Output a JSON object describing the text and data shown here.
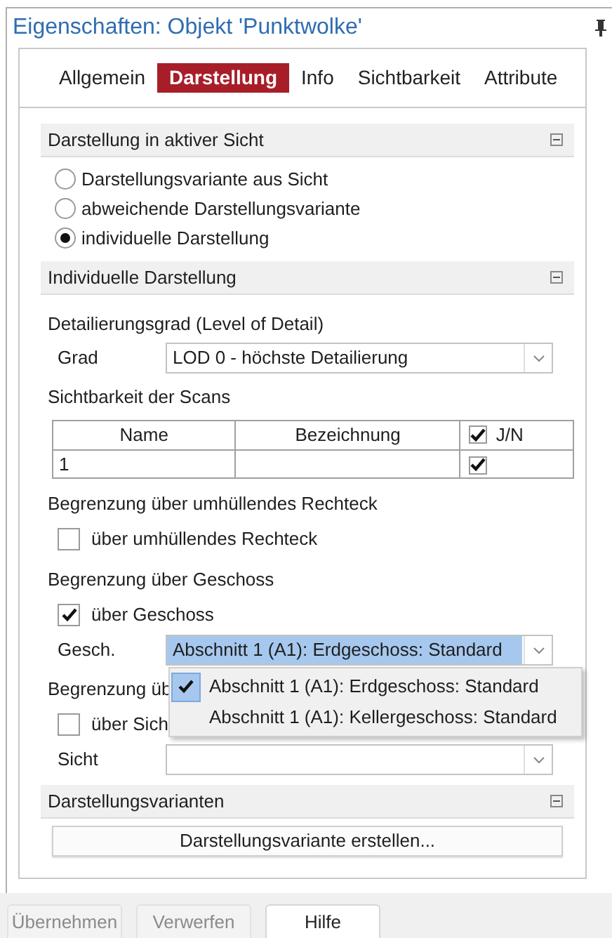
{
  "panel": {
    "title": "Eigenschaften: Objekt 'Punktwolke'"
  },
  "tabs": [
    {
      "label": "Allgemein",
      "selected": false
    },
    {
      "label": "Darstellung",
      "selected": true
    },
    {
      "label": "Info",
      "selected": false
    },
    {
      "label": "Sichtbarkeit",
      "selected": false
    },
    {
      "label": "Attribute",
      "selected": false
    }
  ],
  "sections": [
    {
      "title": "Darstellung in aktiver Sicht",
      "expanded": true,
      "items": [
        {
          "kind": "radio",
          "label": "Darstellungsvariante aus Sicht",
          "selected": false
        },
        {
          "kind": "radio",
          "label": "abweichende Darstellungsvariante",
          "selected": false
        },
        {
          "kind": "radio",
          "label": "individuelle Darstellung",
          "selected": true
        }
      ]
    },
    {
      "title": "Individuelle Darstellung",
      "expanded": true,
      "items": [
        {
          "kind": "label",
          "text": "Detailierungsgrad (Level of Detail)"
        },
        {
          "kind": "combo",
          "label": "Grad",
          "value": "LOD 0 - höchste Detailierung",
          "expanded": false
        },
        {
          "kind": "label",
          "text": "Sichtbarkeit der Scans"
        },
        {
          "kind": "table",
          "columns": [
            {
              "label": "Name"
            },
            {
              "label": "Bezeichnung"
            },
            {
              "label": "J/N",
              "checked": true
            }
          ],
          "rows": [
            {
              "cells": [
                "1"
              ],
              "checked": true
            }
          ]
        },
        {
          "kind": "label",
          "text": "Begrenzung über umhüllendes Rechteck"
        },
        {
          "kind": "checkbox",
          "label": "über umhüllendes Rechteck",
          "checked": false
        },
        {
          "kind": "label",
          "text": "Begrenzung über Geschoss"
        },
        {
          "kind": "checkbox",
          "label": "über Geschoss",
          "checked": true
        },
        {
          "kind": "combo",
          "label": "Gesch.",
          "value": "Abschnitt 1 (A1): Erdgeschoss: Standard",
          "expanded": true,
          "options": [
            {
              "label": "Abschnitt 1 (A1): Erdgeschoss: Standard",
              "selected": true
            },
            {
              "label": "Abschnitt 1 (A1): Kellergeschoss: Standard",
              "selected": false
            }
          ]
        },
        {
          "kind": "label",
          "text": "Begrenzung üb"
        },
        {
          "kind": "checkbox",
          "label": "über Sich",
          "checked": false
        },
        {
          "kind": "combo",
          "label": "Sicht",
          "expanded": false
        }
      ]
    },
    {
      "title": "Darstellungsvarianten",
      "expanded": true,
      "items": [
        {
          "kind": "button",
          "label": "Darstellungsvariante erstellen..."
        }
      ]
    }
  ],
  "footer_buttons": [
    {
      "label": "Übernehmen",
      "disabled": true
    },
    {
      "label": "Verwerfen",
      "disabled": true
    },
    {
      "label": "Hilfe",
      "disabled": false
    }
  ]
}
